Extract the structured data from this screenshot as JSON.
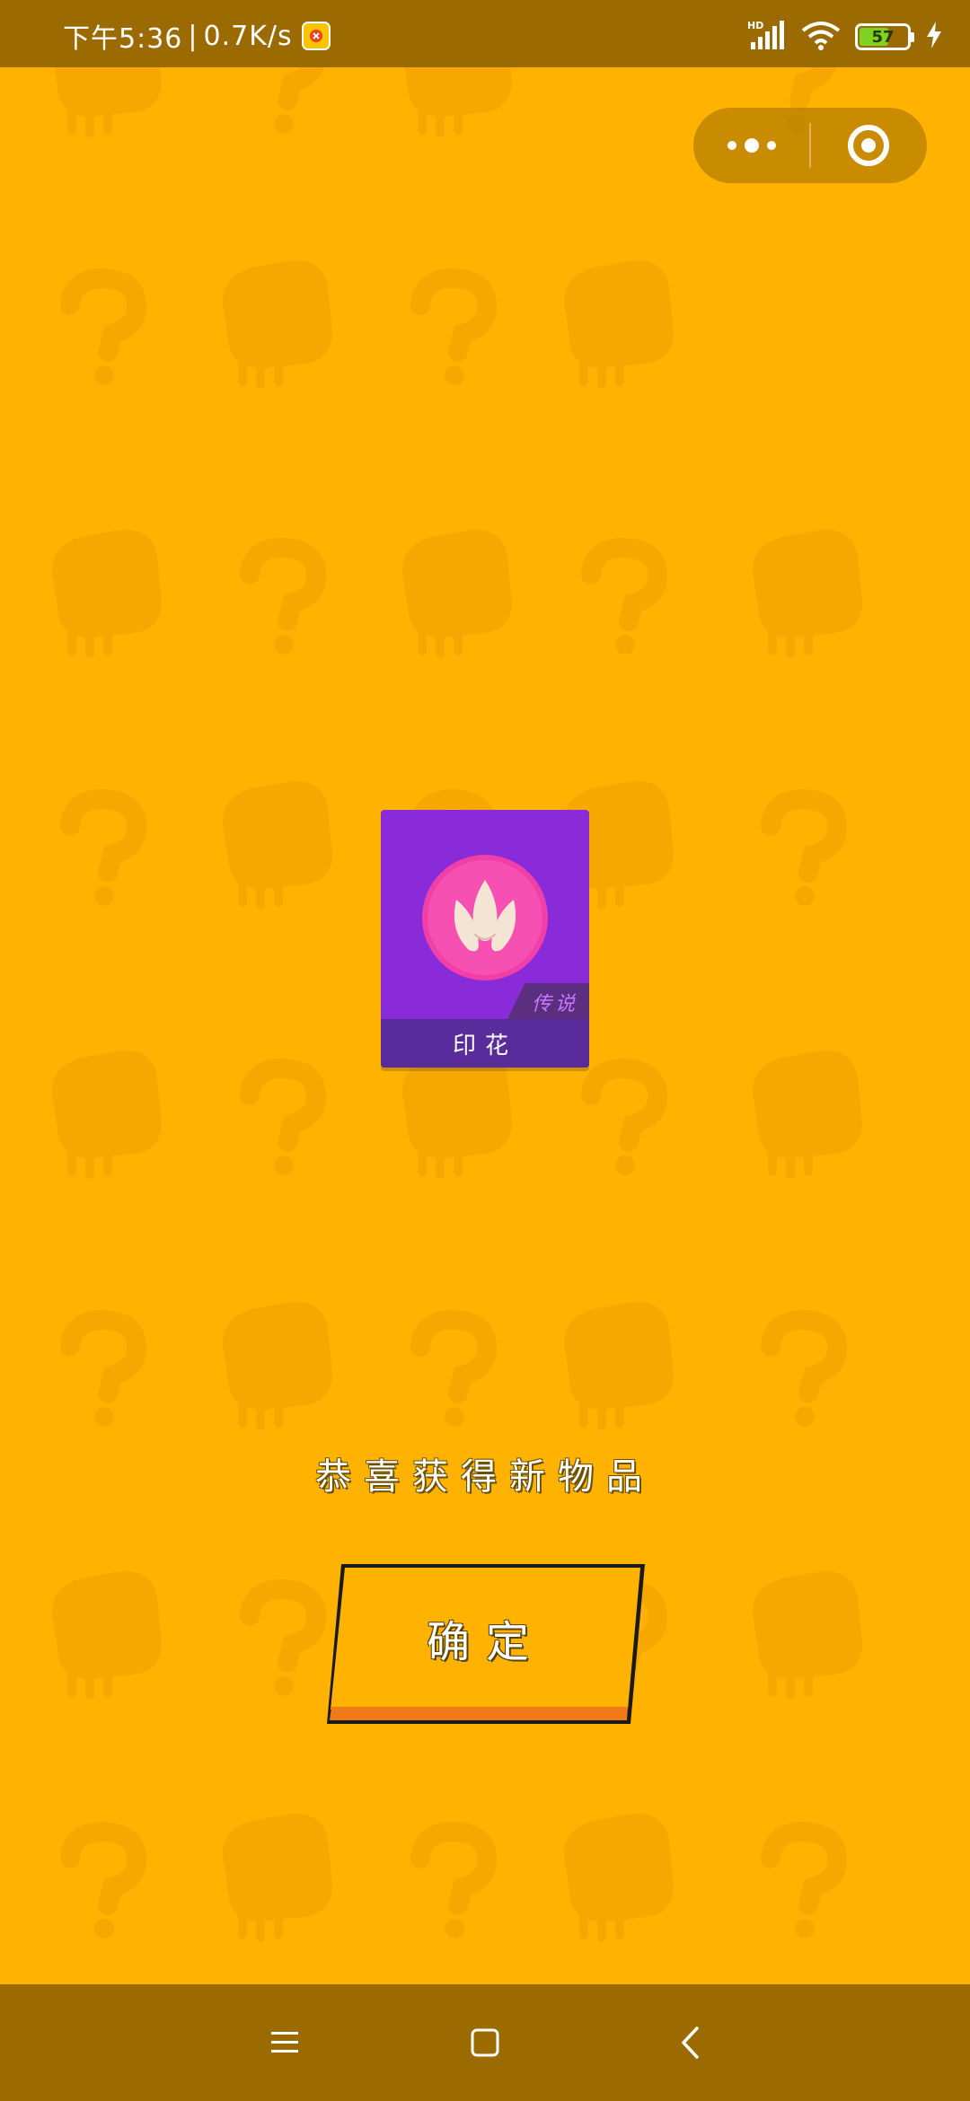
{
  "status_bar": {
    "time": "下午5:36",
    "speed": "0.7K/s",
    "network_label": "HD",
    "battery_level": "57",
    "charging": true
  },
  "capsule": {
    "more_icon": "more-dots-icon",
    "close_icon": "target-circle-icon"
  },
  "item": {
    "name": "印花",
    "rarity": "传说",
    "icon": "lotus-icon",
    "card_color": "#8A2BD9",
    "icon_bg_color": "#F23FA8"
  },
  "message": "恭喜获得新物品",
  "confirm_label": "确定",
  "colors": {
    "background": "#FFB300",
    "bars": "#9B6A00",
    "button_bottom": "#F07A1A"
  },
  "nav": {
    "menu_icon": "menu-icon",
    "home_icon": "home-square-icon",
    "back_icon": "back-chevron-icon"
  }
}
